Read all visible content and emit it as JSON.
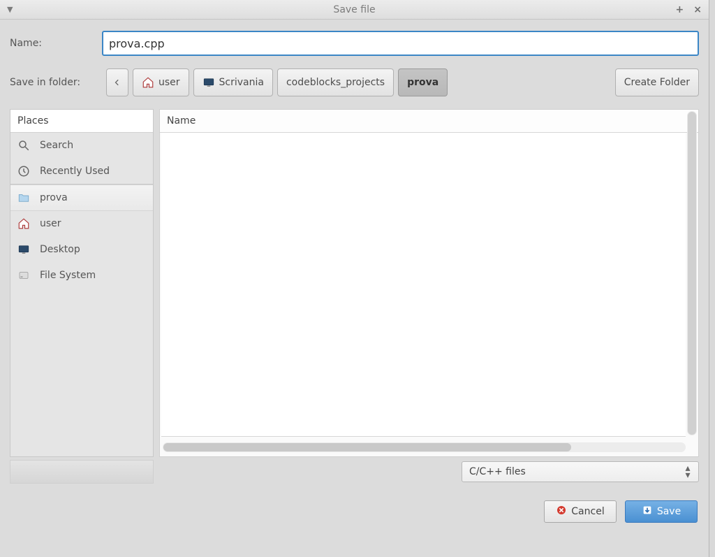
{
  "window": {
    "title": "Save file"
  },
  "name_row": {
    "label": "Name:",
    "value": "prova.cpp"
  },
  "folder_row": {
    "label": "Save in folder:",
    "segments": [
      "user",
      "Scrivania",
      "codeblocks_projects",
      "prova"
    ],
    "create_button": "Create Folder"
  },
  "places": {
    "header": "Places",
    "items": [
      {
        "label": "Search",
        "icon": "search"
      },
      {
        "label": "Recently Used",
        "icon": "recent"
      },
      {
        "label": "prova",
        "icon": "folder"
      },
      {
        "label": "user",
        "icon": "home"
      },
      {
        "label": "Desktop",
        "icon": "desktop"
      },
      {
        "label": "File System",
        "icon": "disk"
      }
    ]
  },
  "filelist": {
    "column_name": "Name"
  },
  "filetype": {
    "selected": "C/C++ files"
  },
  "actions": {
    "cancel": "Cancel",
    "save": "Save"
  }
}
